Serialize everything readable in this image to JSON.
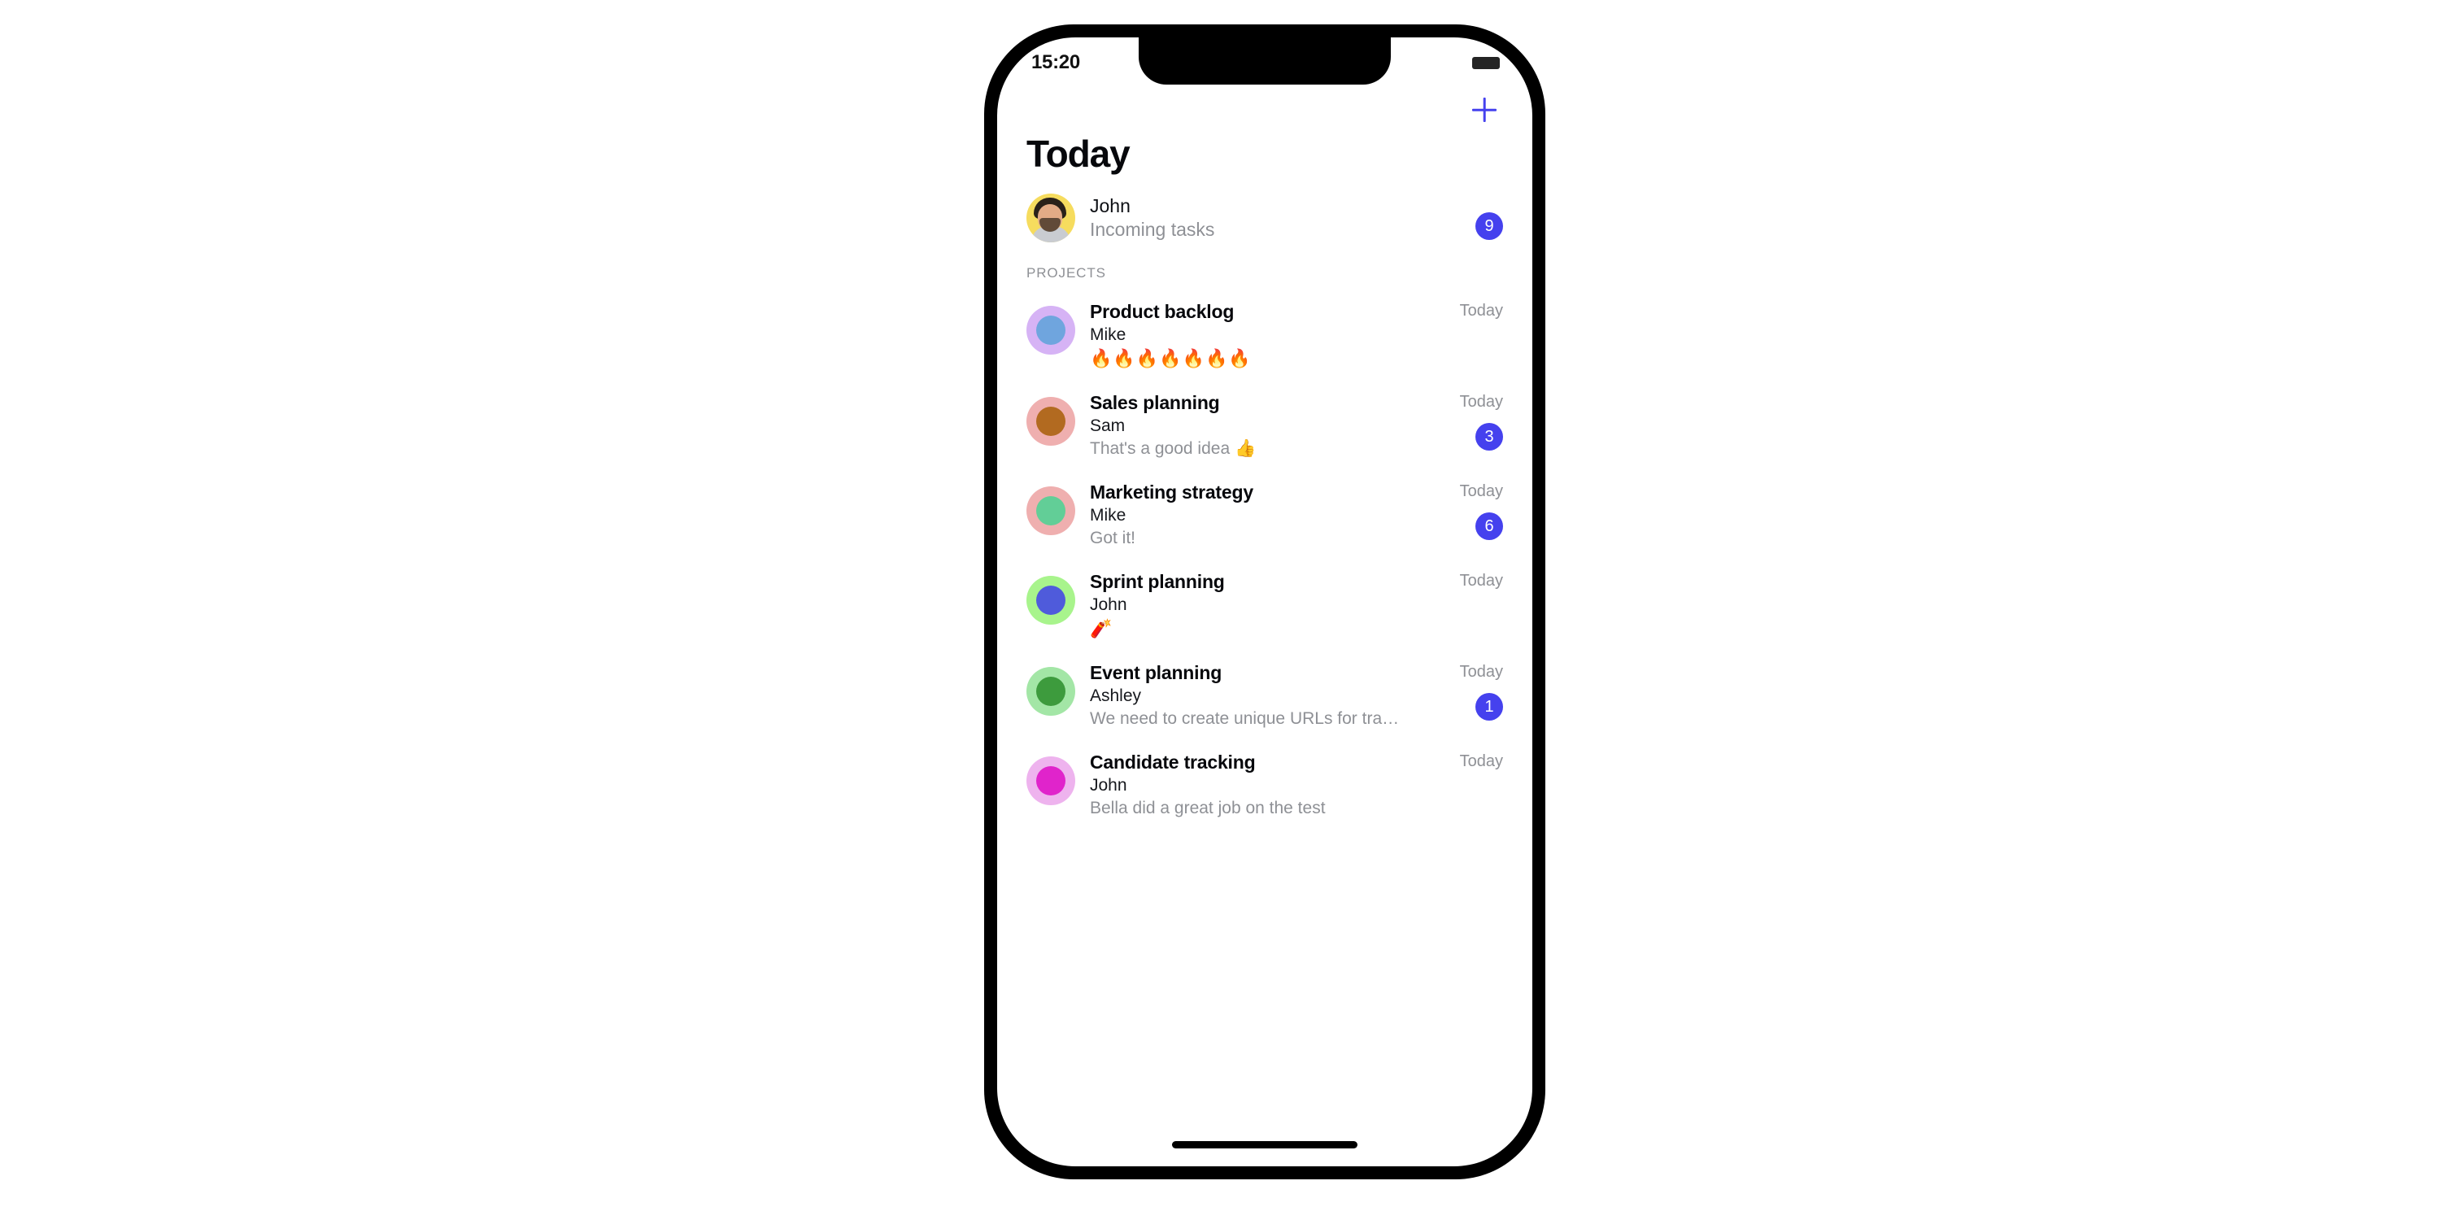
{
  "device": {
    "status_bar": {
      "time": "15:20",
      "battery_icon": "battery-icon"
    },
    "home_indicator": "home-indicator"
  },
  "nav": {
    "add_icon": "plus-icon",
    "add_label": "+"
  },
  "header": {
    "title": "Today"
  },
  "user": {
    "name": "John",
    "subtitle": "Incoming tasks",
    "badge": "9",
    "avatar_bg": "#F6DC5E"
  },
  "sections": {
    "projects_label": "PROJECTS"
  },
  "colors": {
    "accent": "#4541EE",
    "badge_bg": "#4541EE",
    "badge_text": "#FFFFFF",
    "title_text": "#07080C",
    "muted_text": "#8E9095"
  },
  "projects": [
    {
      "title": "Product backlog",
      "author": "Mike",
      "preview": "🔥🔥🔥🔥🔥🔥🔥",
      "date": "Today",
      "badge": "",
      "avatar_outer": "#D6B3F5",
      "avatar_inner": "#6FA5DE"
    },
    {
      "title": "Sales planning",
      "author": "Sam",
      "preview": "That's a good idea 👍",
      "date": "Today",
      "badge": "3",
      "avatar_outer": "#EFAFAF",
      "avatar_inner": "#B26A20"
    },
    {
      "title": "Marketing strategy",
      "author": "Mike",
      "preview": "Got it!",
      "date": "Today",
      "badge": "6",
      "avatar_outer": "#EFAFAF",
      "avatar_inner": "#62CE97"
    },
    {
      "title": "Sprint planning",
      "author": "John",
      "preview": "🧨",
      "date": "Today",
      "badge": "",
      "avatar_outer": "#A8F48C",
      "avatar_inner": "#4F5BDB"
    },
    {
      "title": "Event planning",
      "author": "Ashley",
      "preview": "We need to create unique URLs for tra…",
      "date": "Today",
      "badge": "1",
      "avatar_outer": "#A3E6A6",
      "avatar_inner": "#3D9B3D"
    },
    {
      "title": "Candidate tracking",
      "author": "John",
      "preview": "Bella did a great job on the test",
      "date": "Today",
      "badge": "",
      "avatar_outer": "#EEB3EE",
      "avatar_inner": "#E024CB"
    }
  ]
}
